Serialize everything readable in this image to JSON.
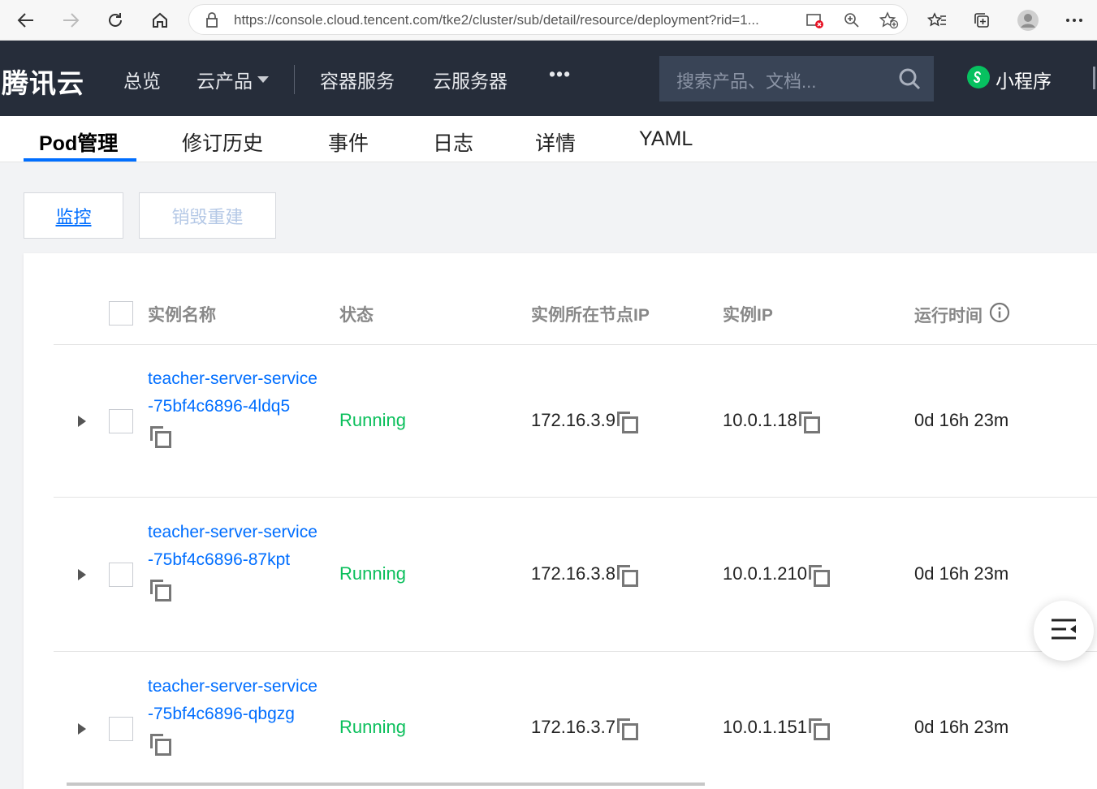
{
  "browser": {
    "url": "https://console.cloud.tencent.com/tke2/cluster/sub/detail/resource/deployment?rid=1..."
  },
  "topnav": {
    "brand": "腾讯云",
    "items": [
      "总览",
      "云产品",
      "容器服务",
      "云服务器",
      "•••"
    ],
    "search_placeholder": "搜索产品、文档...",
    "mini_program": "小程序"
  },
  "tabs": [
    "Pod管理",
    "修订历史",
    "事件",
    "日志",
    "详情",
    "YAML"
  ],
  "actions": {
    "monitor": "监控",
    "rebuild": "销毁重建"
  },
  "table": {
    "headers": [
      "实例名称",
      "状态",
      "实例所在节点IP",
      "实例IP",
      "运行时间"
    ],
    "rows": [
      {
        "name": "teacher-server-service-75bf4c6896-4ldq5",
        "status": "Running",
        "node_ip": "172.16.3.9",
        "pod_ip": "10.0.1.18",
        "uptime": "0d 16h 23m"
      },
      {
        "name": "teacher-server-service-75bf4c6896-87kpt",
        "status": "Running",
        "node_ip": "172.16.3.8",
        "pod_ip": "10.0.1.210",
        "uptime": "0d 16h 23m"
      },
      {
        "name": "teacher-server-service-75bf4c6896-qbgzg",
        "status": "Running",
        "node_ip": "172.16.3.7",
        "pod_ip": "10.0.1.151",
        "uptime": "0d 16h 23m"
      }
    ]
  },
  "colors": {
    "nav_bg": "#262d3a",
    "accent": "#006eff",
    "running": "#0abf5b"
  }
}
